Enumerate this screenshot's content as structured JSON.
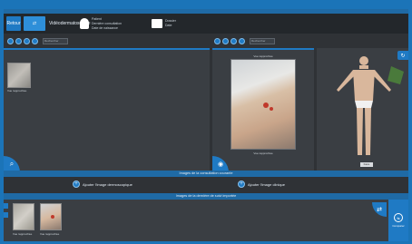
{
  "header": {
    "back_label": "Retour",
    "mode_label": "Vidéodermatoscopie",
    "patient_line1": "Patient",
    "patient_line2": "Dernière consultation",
    "patient_line3": "Date de naissance",
    "card_line1": "Dossier",
    "card_line2": "Date"
  },
  "toolbar_left": {
    "search_placeholder": "Rechercher"
  },
  "toolbar_right": {
    "search_placeholder": "Rechercher"
  },
  "left_panel": {
    "thumb_caption": "Vue rapprochée"
  },
  "mid_panel": {
    "photo_title": "Vue rapprochée",
    "photo_caption": "Vue rapprochée"
  },
  "right_panel": {
    "avatar_button": "Face"
  },
  "bars": {
    "consultation": "Images de la consultation courante",
    "previous": "Images de la dernière de suivi importée"
  },
  "actions": {
    "add_dermoscopic": "Ajouter l'image dermoscopique",
    "add_clinical": "Ajouter l'image clinique"
  },
  "bottom": {
    "thumb1_caption": "Vue rapprochée",
    "thumb2_caption": "Vue rapprochée",
    "compare_label": "Comparer"
  },
  "colors": {
    "accent": "#1f7ac4",
    "background": "#2f3236",
    "panel": "#3a3e43"
  }
}
